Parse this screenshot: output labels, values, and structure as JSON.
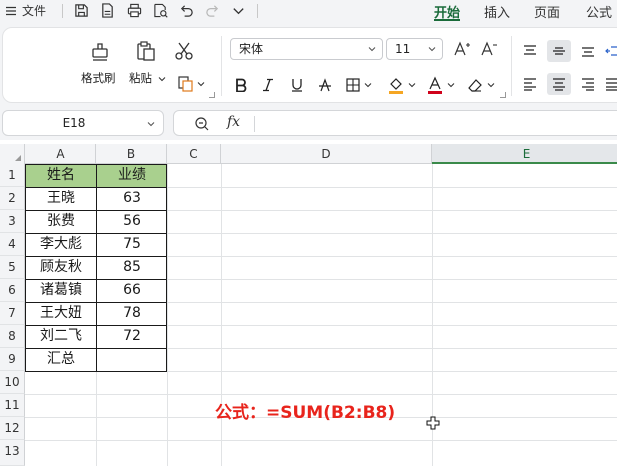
{
  "menubar": {
    "file_label": "文件",
    "tabs": [
      {
        "label": "开始",
        "active": true
      },
      {
        "label": "插入",
        "active": false
      },
      {
        "label": "页面",
        "active": false
      },
      {
        "label": "公式",
        "active": false
      }
    ]
  },
  "ribbon": {
    "format_painter": "格式刷",
    "paste": "粘贴",
    "font_name": "宋体",
    "font_size": "11"
  },
  "formula_bar": {
    "name_box": "E18",
    "fx": "fx",
    "content": ""
  },
  "sheet": {
    "columns": [
      "A",
      "B",
      "C",
      "D",
      "E"
    ],
    "selected_column": "E",
    "rows": [
      "1",
      "2",
      "3",
      "4",
      "5",
      "6",
      "7",
      "8",
      "9",
      "10",
      "11",
      "12",
      "13"
    ],
    "header": {
      "a": "姓名",
      "b": "业绩"
    },
    "records": [
      {
        "name": "王晓",
        "score": "63"
      },
      {
        "name": "张费",
        "score": "56"
      },
      {
        "name": "李大彪",
        "score": "75"
      },
      {
        "name": "顾友秋",
        "score": "85"
      },
      {
        "name": "诸葛镇",
        "score": "66"
      },
      {
        "name": "王大妞",
        "score": "78"
      },
      {
        "name": "刘二飞",
        "score": "72"
      }
    ],
    "total_label": "汇总",
    "total_value": "",
    "header_fill": "#a9d08e",
    "note": "公式：=SUM(B2:B8)",
    "note_color": "#e8241c"
  },
  "colors": {
    "accent": "#1a6b3a"
  }
}
